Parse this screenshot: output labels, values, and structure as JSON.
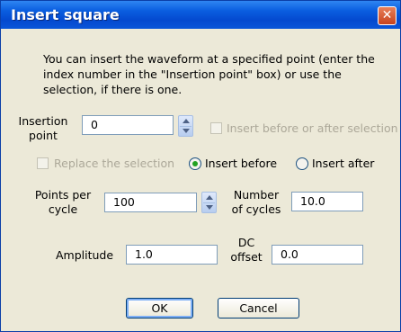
{
  "window": {
    "title": "Insert square",
    "close_glyph": "✕"
  },
  "intro_text": "You can insert the waveform at a specified point (enter the index number in the \"Insertion point\" box) or use the selection, if there is one.",
  "insertion_point": {
    "label": "Insertion point",
    "value": "0"
  },
  "insert_before_after_selection": {
    "label": "Insert before or after selection",
    "checked": false,
    "enabled": false
  },
  "replace_selection": {
    "label": "Replace the selection",
    "checked": false,
    "enabled": false
  },
  "insert_before": {
    "label": "Insert before",
    "selected": true
  },
  "insert_after": {
    "label": "Insert after",
    "selected": false
  },
  "points_per_cycle": {
    "label": "Points per cycle",
    "value": "100"
  },
  "number_of_cycles": {
    "label": "Number of cycles",
    "value": "10.0"
  },
  "amplitude": {
    "label": "Amplitude",
    "value": "1.0"
  },
  "dc_offset": {
    "label": "DC offset",
    "value": "0.0"
  },
  "buttons": {
    "ok": "OK",
    "cancel": "Cancel"
  },
  "colors": {
    "titlebar": "#0a5ee0",
    "dialog_bg": "#ece9d8",
    "close": "#c8431e",
    "radio_dot": "#21a121"
  }
}
